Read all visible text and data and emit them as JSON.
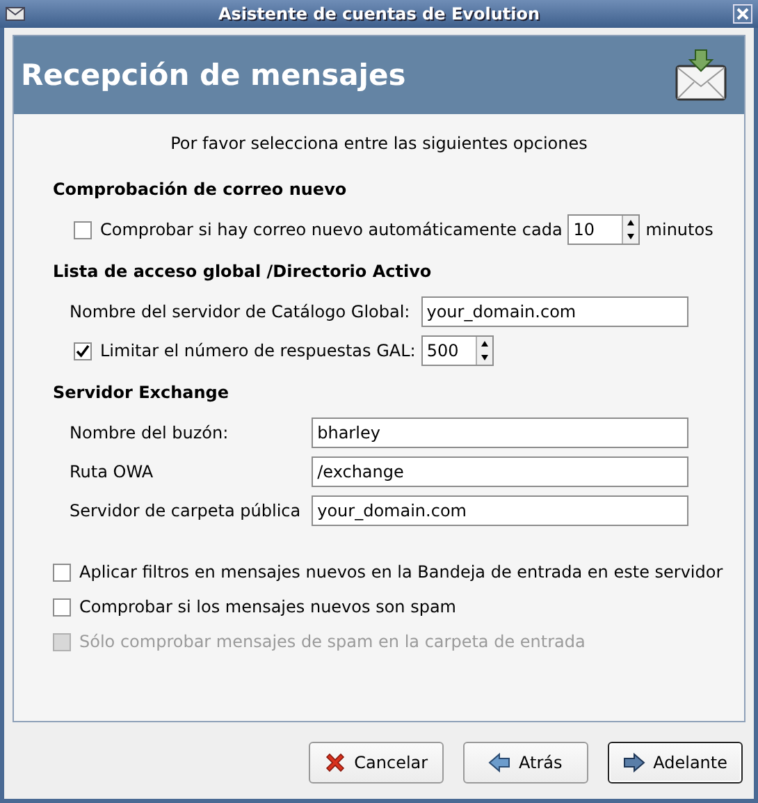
{
  "window": {
    "title": "Asistente de cuentas de Evolution"
  },
  "header": {
    "title": "Recepción de mensajes"
  },
  "intro": "Por favor selecciona entre las siguientes opciones",
  "sections": [
    {
      "title": "Comprobación de correo nuevo",
      "rows": [
        {
          "kind": "check-spin",
          "label": "Comprobar si hay correo nuevo automáticamente cada",
          "checked": false,
          "value": "10",
          "suffix": "minutos"
        }
      ]
    },
    {
      "title": "Lista de acceso global /Directorio Activo",
      "rows": [
        {
          "kind": "field",
          "label": "Nombre del servidor de Catálogo Global:",
          "value": "your_domain.com"
        },
        {
          "kind": "check-spin",
          "label": "Limitar el número de respuestas GAL:",
          "checked": true,
          "value": "500"
        }
      ]
    },
    {
      "title": "Servidor Exchange",
      "rows": [
        {
          "kind": "field",
          "label": "Nombre del buzón:",
          "value": "bharley"
        },
        {
          "kind": "field",
          "label": "Ruta OWA",
          "value": "/exchange"
        },
        {
          "kind": "field",
          "label": "Servidor de carpeta pública",
          "value": "your_domain.com"
        }
      ]
    }
  ],
  "options": [
    {
      "label": "Aplicar filtros en mensajes nuevos en la Bandeja de entrada en este servidor",
      "checked": false,
      "disabled": false
    },
    {
      "label": "Comprobar si los mensajes nuevos son spam",
      "checked": false,
      "disabled": false
    },
    {
      "label": "Sólo comprobar mensajes de spam en la carpeta de entrada",
      "checked": false,
      "disabled": true
    }
  ],
  "buttons": [
    {
      "label": "Cancelar",
      "kind": "cancel",
      "default": false
    },
    {
      "label": "Atrás",
      "kind": "back",
      "default": false
    },
    {
      "label": "Adelante",
      "kind": "forward",
      "default": true
    }
  ]
}
